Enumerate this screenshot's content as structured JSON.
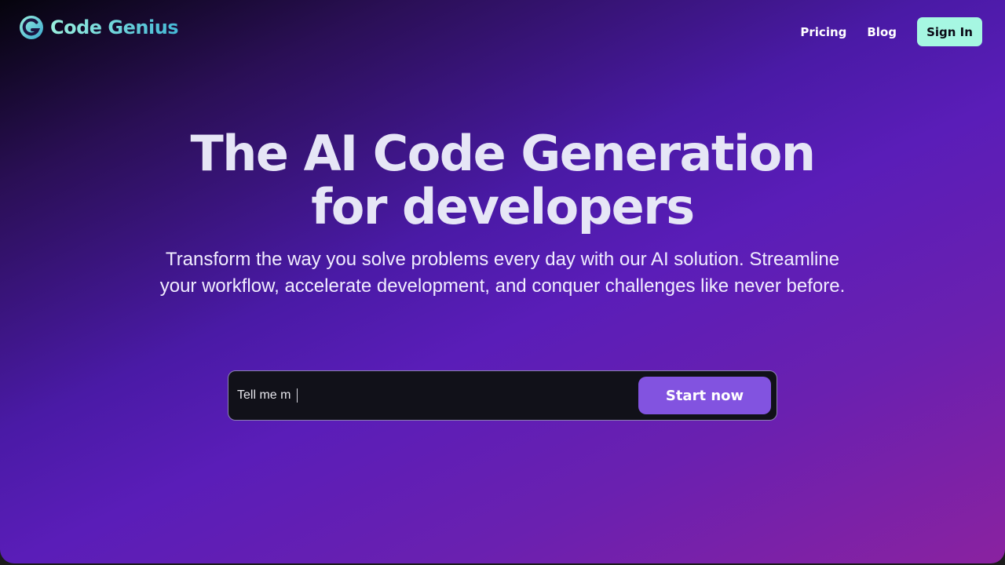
{
  "brand": {
    "name": "Code Genius",
    "logo_icon": "g-logo-icon"
  },
  "nav": {
    "links": [
      {
        "label": "Pricing"
      },
      {
        "label": "Blog"
      }
    ],
    "signin_label": "Sign In"
  },
  "hero": {
    "title_line1": "The AI Code Generation",
    "title_line2": "for developers",
    "subtitle": "Transform the way you solve problems every day with our AI solution. Streamline your workflow, accelerate development, and conquer challenges like never before."
  },
  "prompt": {
    "value": "Tell me m",
    "submit_label": "Start now"
  },
  "colors": {
    "accent": "#8253e0",
    "signin_bg": "#a6f7e2",
    "logo_gradient_start": "#9af0de",
    "logo_gradient_end": "#45b8d6"
  }
}
